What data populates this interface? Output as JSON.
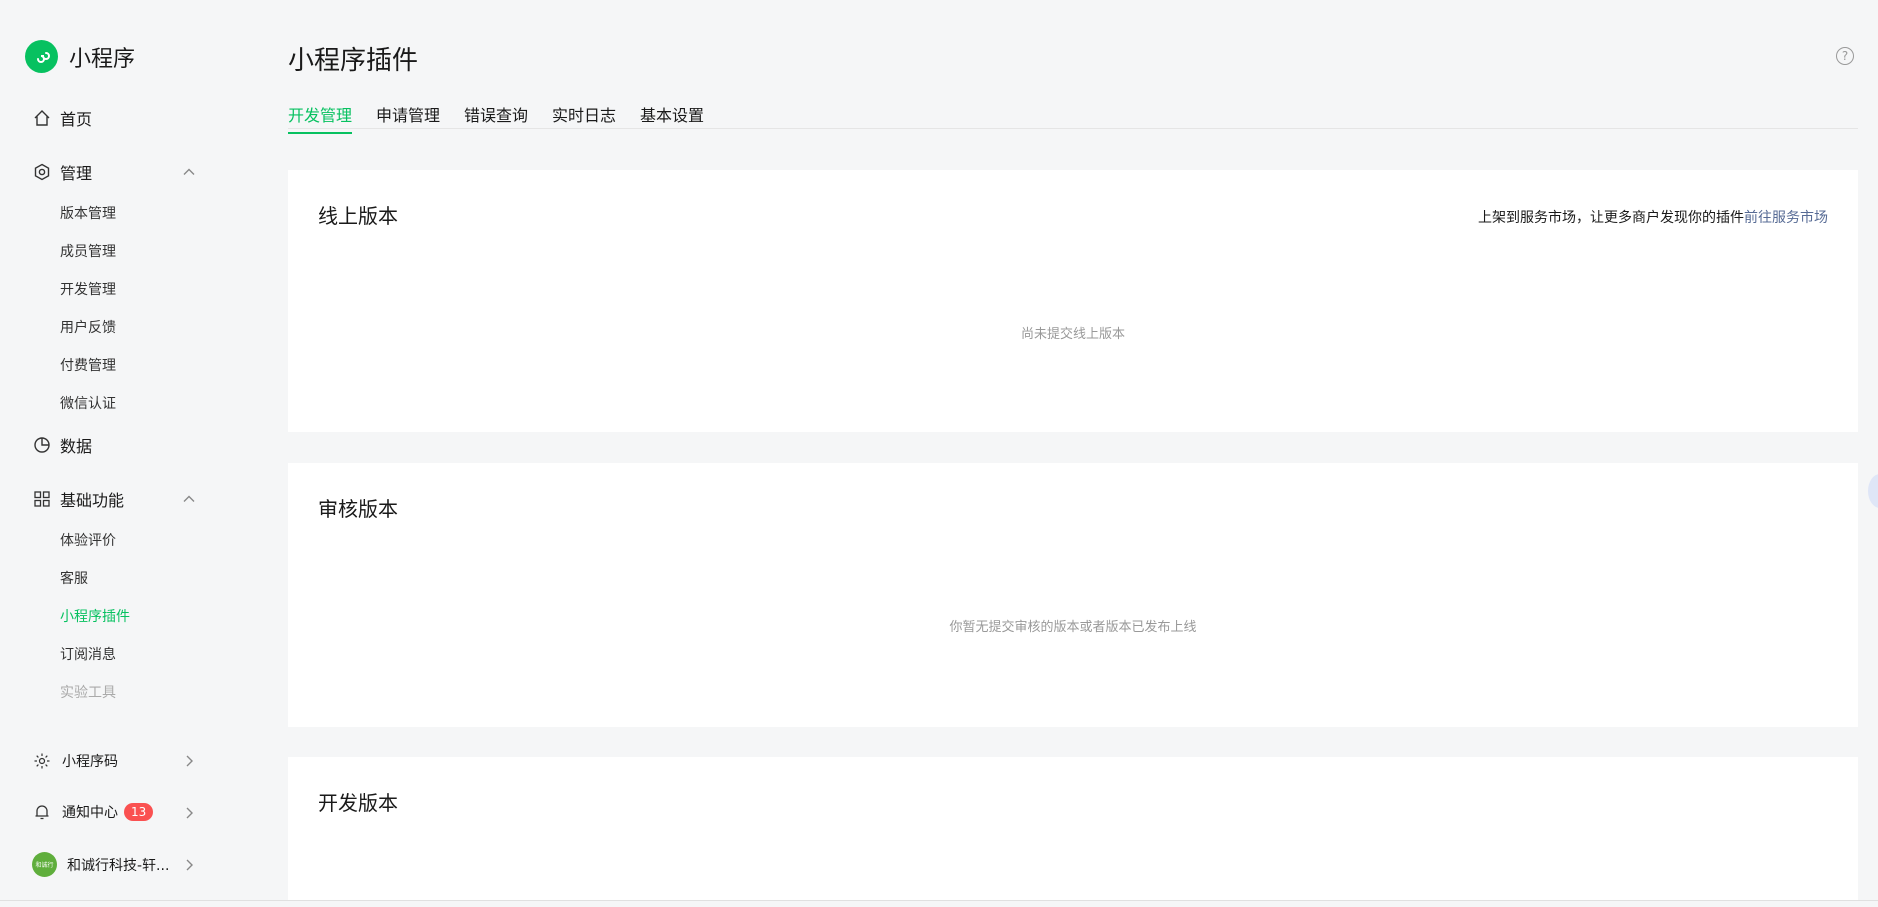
{
  "brand": {
    "name": "小程序"
  },
  "sidebar": {
    "home": "首页",
    "manage": {
      "label": "管理",
      "items": [
        "版本管理",
        "成员管理",
        "开发管理",
        "用户反馈",
        "付费管理",
        "微信认证"
      ]
    },
    "data": "数据",
    "basic": {
      "label": "基础功能",
      "items": [
        "体验评价",
        "客服",
        "小程序插件",
        "订阅消息",
        "实验工具"
      ],
      "active": "小程序插件"
    },
    "bottom": {
      "qrcode": "小程序码",
      "notify": {
        "label": "通知中心",
        "count": "13"
      },
      "account": {
        "name": "和诚行科技-轩...",
        "avatar_text": "和诚行"
      }
    }
  },
  "header": {
    "title": "小程序插件",
    "help_icon": "?"
  },
  "tabs": [
    "开发管理",
    "申请管理",
    "错误查询",
    "实时日志",
    "基本设置"
  ],
  "active_tab": "开发管理",
  "cards": {
    "online": {
      "title": "线上版本",
      "promo_text": "上架到服务市场，让更多商户发现你的插件",
      "promo_link": "前往服务市场",
      "empty": "尚未提交线上版本"
    },
    "review": {
      "title": "审核版本",
      "empty": "你暂无提交审核的版本或者版本已发布上线"
    },
    "dev": {
      "title": "开发版本"
    }
  },
  "colors": {
    "accent": "#07c160",
    "link": "#576b95",
    "badge": "#fa5151"
  }
}
